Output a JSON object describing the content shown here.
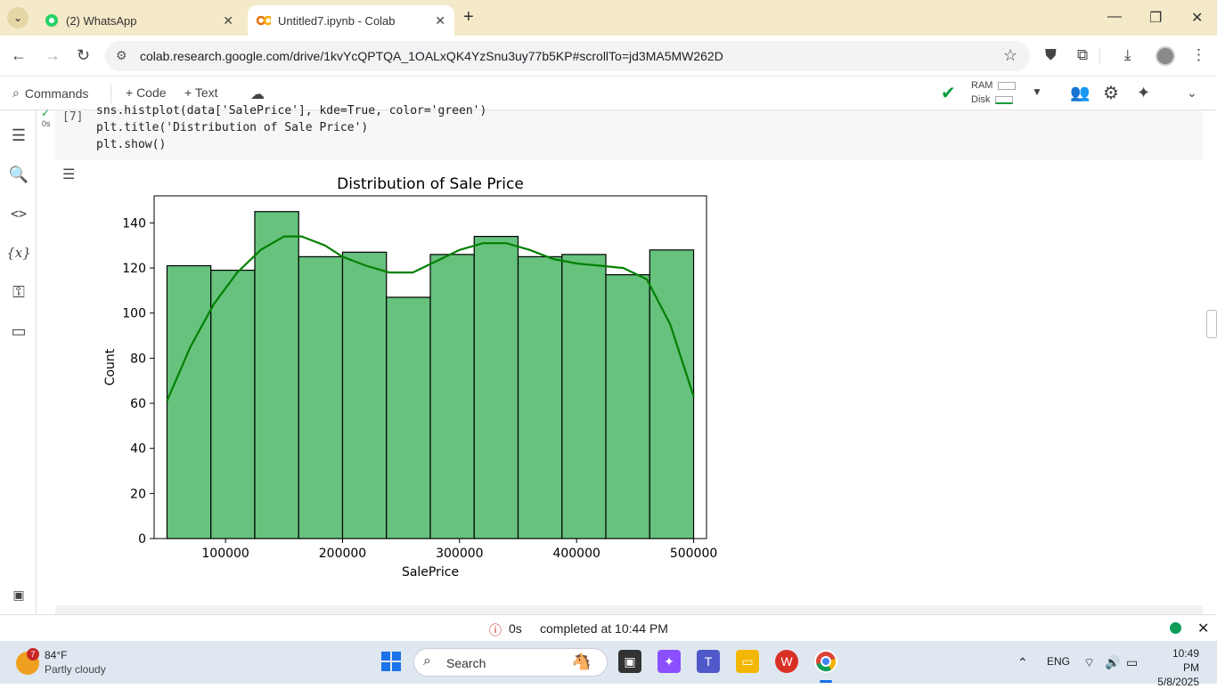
{
  "browser": {
    "tabs": [
      {
        "title": "(2) WhatsApp",
        "icon": "whatsapp-icon"
      },
      {
        "title": "Untitled7.ipynb - Colab",
        "icon": "colab-icon",
        "active": true
      }
    ],
    "url": "colab.research.google.com/drive/1kvYcQPTQA_1OALxQK4YzSnu3uy77b5KP#scrollTo=jd3MA5MW262D"
  },
  "toolbar": {
    "commands": "Commands",
    "code": "+ Code",
    "text": "+ Text",
    "ram": "RAM",
    "disk": "Disk"
  },
  "cell": {
    "exec_count": "[7]",
    "duration": "0s",
    "code_lines": [
      "sns.histplot(data['SalePrice'], kde=True, color='green')",
      "plt.title('Distribution of Sale Price')",
      "plt.show()"
    ]
  },
  "chart_data": {
    "type": "bar",
    "title": "Distribution of Sale Price",
    "xlabel": "SalePrice",
    "ylabel": "Count",
    "bin_edges": [
      50000,
      87500,
      125000,
      162500,
      200000,
      237500,
      275000,
      312500,
      350000,
      387500,
      425000,
      462500,
      500000
    ],
    "values": [
      121,
      119,
      145,
      125,
      127,
      107,
      126,
      134,
      125,
      126,
      117,
      128
    ],
    "kde": [
      [
        50000,
        61
      ],
      [
        70000,
        85
      ],
      [
        90000,
        104
      ],
      [
        110000,
        118
      ],
      [
        130000,
        128
      ],
      [
        150000,
        134
      ],
      [
        165000,
        134
      ],
      [
        185000,
        130
      ],
      [
        200000,
        125
      ],
      [
        220000,
        121
      ],
      [
        240000,
        118
      ],
      [
        260000,
        118
      ],
      [
        280000,
        123
      ],
      [
        300000,
        128
      ],
      [
        320000,
        131
      ],
      [
        340000,
        131
      ],
      [
        360000,
        128
      ],
      [
        380000,
        124
      ],
      [
        400000,
        122
      ],
      [
        420000,
        121
      ],
      [
        440000,
        120
      ],
      [
        460000,
        115
      ],
      [
        480000,
        95
      ],
      [
        500000,
        63
      ]
    ],
    "xticks": [
      100000,
      200000,
      300000,
      400000,
      500000
    ],
    "yticks": [
      0,
      20,
      40,
      60,
      80,
      100,
      120,
      140
    ],
    "xlim": [
      39000,
      511000
    ],
    "ylim": [
      0,
      152
    ],
    "bar_color": "#66c27d",
    "kde_color": "#008000"
  },
  "status": {
    "duration": "0s",
    "message": "completed at 10:44 PM"
  },
  "taskbar": {
    "weather_temp": "84°F",
    "weather_desc": "Partly cloudy",
    "weather_badge": "7",
    "search": "Search",
    "lang": "ENG",
    "time": "10:49 PM",
    "date": "5/8/2025"
  }
}
